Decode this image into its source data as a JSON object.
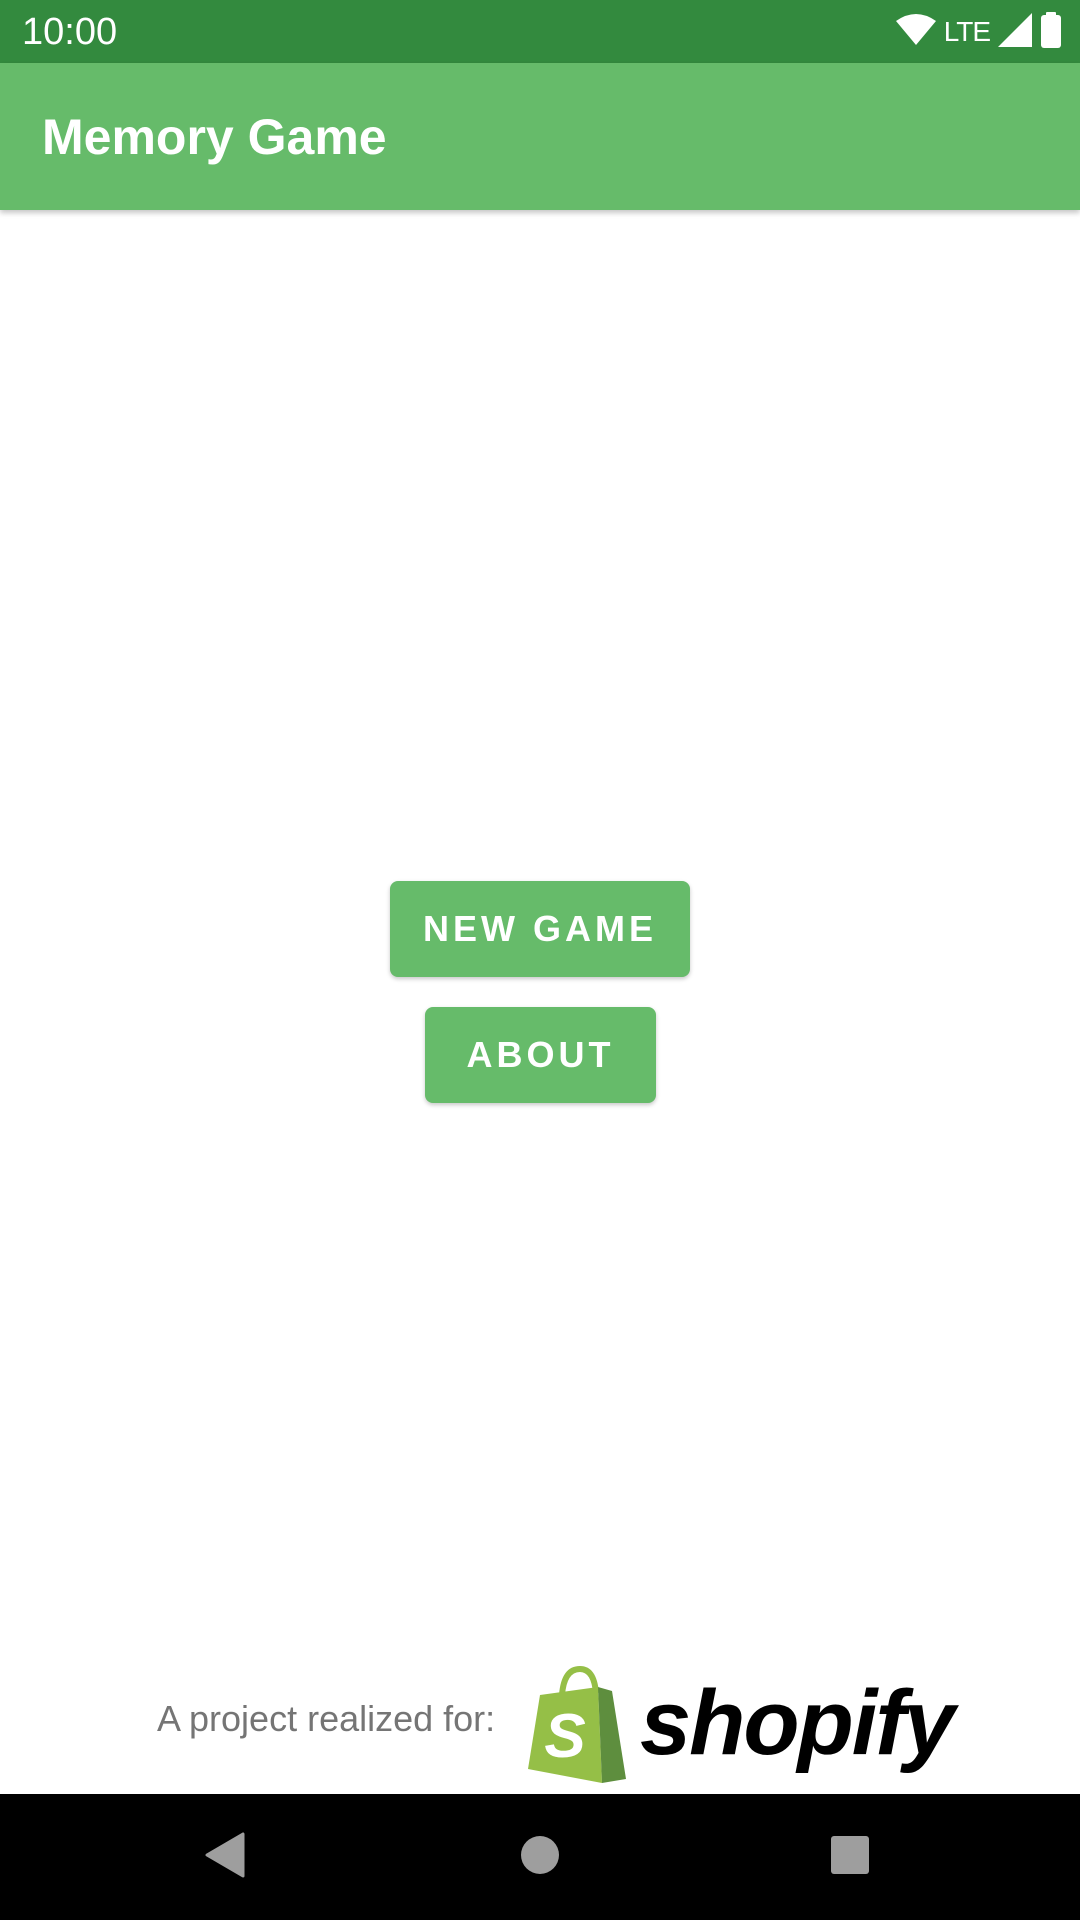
{
  "status_bar": {
    "time": "10:00",
    "network": "LTE",
    "icons": [
      "wifi-icon",
      "cell-signal-icon",
      "battery-icon"
    ]
  },
  "app_bar": {
    "title": "Memory Game"
  },
  "main": {
    "new_game_label": "NEW GAME",
    "about_label": "ABOUT"
  },
  "footer": {
    "credit_text": "A project realized for:",
    "brand_name": "shopify",
    "brand_logo": "shopify-bag-icon"
  },
  "nav_bar": {
    "icons": [
      "back-icon",
      "home-icon",
      "recents-icon"
    ]
  },
  "colors": {
    "status_bar": "#338a3e",
    "primary": "#66bb6a",
    "on_primary": "#ffffff",
    "credit_text": "#757575",
    "nav_bar": "#000000",
    "shopify_green_light": "#95bf47",
    "shopify_green_dark": "#5e8e3e"
  }
}
